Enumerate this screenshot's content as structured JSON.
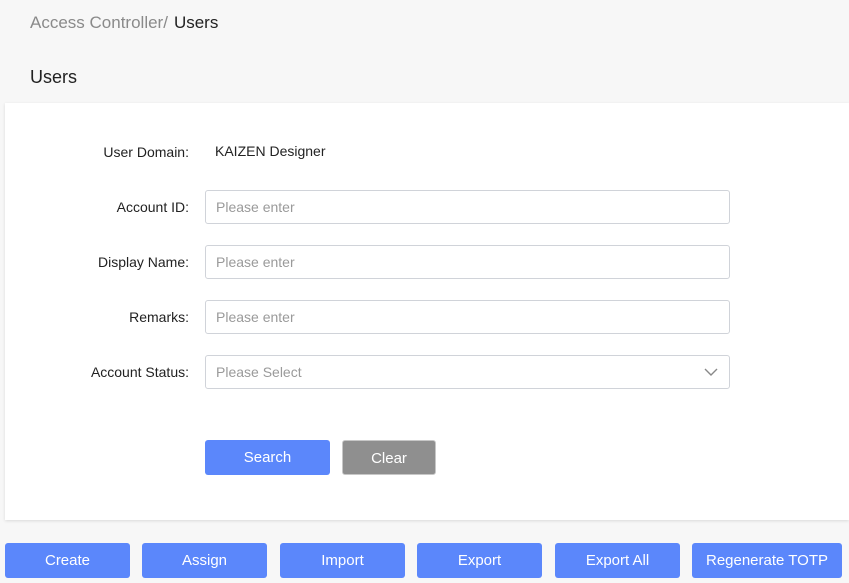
{
  "breadcrumb": {
    "parent": "Access Controller/",
    "current": "Users"
  },
  "page_title": "Users",
  "form": {
    "user_domain": {
      "label": "User Domain:",
      "value": "KAIZEN Designer"
    },
    "account_id": {
      "label": "Account ID:",
      "placeholder": "Please enter",
      "value": ""
    },
    "display_name": {
      "label": "Display Name:",
      "placeholder": "Please enter",
      "value": ""
    },
    "remarks": {
      "label": "Remarks:",
      "placeholder": "Please enter",
      "value": ""
    },
    "account_status": {
      "label": "Account Status:",
      "placeholder": "Please Select",
      "icon": "chevron-down-icon"
    },
    "search_label": "Search",
    "clear_label": "Clear"
  },
  "actions": {
    "create": "Create",
    "assign": "Assign",
    "import": "Import",
    "export": "Export",
    "export_all": "Export All",
    "regenerate_totp": "Regenerate TOTP"
  },
  "colors": {
    "primary": "#5b87fb",
    "clear_button": "#8f8f8f",
    "background": "#f7f7f7",
    "panel": "#ffffff"
  }
}
